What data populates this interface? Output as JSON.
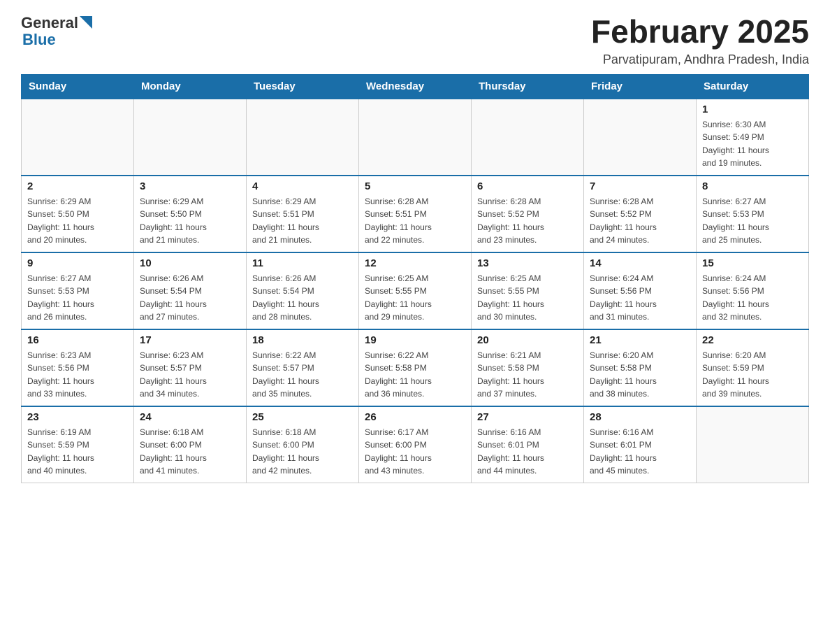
{
  "header": {
    "logo_text_general": "General",
    "logo_text_blue": "Blue",
    "title": "February 2025",
    "subtitle": "Parvatipuram, Andhra Pradesh, India"
  },
  "weekdays": [
    "Sunday",
    "Monday",
    "Tuesday",
    "Wednesday",
    "Thursday",
    "Friday",
    "Saturday"
  ],
  "weeks": [
    [
      {
        "day": "",
        "info": ""
      },
      {
        "day": "",
        "info": ""
      },
      {
        "day": "",
        "info": ""
      },
      {
        "day": "",
        "info": ""
      },
      {
        "day": "",
        "info": ""
      },
      {
        "day": "",
        "info": ""
      },
      {
        "day": "1",
        "info": "Sunrise: 6:30 AM\nSunset: 5:49 PM\nDaylight: 11 hours\nand 19 minutes."
      }
    ],
    [
      {
        "day": "2",
        "info": "Sunrise: 6:29 AM\nSunset: 5:50 PM\nDaylight: 11 hours\nand 20 minutes."
      },
      {
        "day": "3",
        "info": "Sunrise: 6:29 AM\nSunset: 5:50 PM\nDaylight: 11 hours\nand 21 minutes."
      },
      {
        "day": "4",
        "info": "Sunrise: 6:29 AM\nSunset: 5:51 PM\nDaylight: 11 hours\nand 21 minutes."
      },
      {
        "day": "5",
        "info": "Sunrise: 6:28 AM\nSunset: 5:51 PM\nDaylight: 11 hours\nand 22 minutes."
      },
      {
        "day": "6",
        "info": "Sunrise: 6:28 AM\nSunset: 5:52 PM\nDaylight: 11 hours\nand 23 minutes."
      },
      {
        "day": "7",
        "info": "Sunrise: 6:28 AM\nSunset: 5:52 PM\nDaylight: 11 hours\nand 24 minutes."
      },
      {
        "day": "8",
        "info": "Sunrise: 6:27 AM\nSunset: 5:53 PM\nDaylight: 11 hours\nand 25 minutes."
      }
    ],
    [
      {
        "day": "9",
        "info": "Sunrise: 6:27 AM\nSunset: 5:53 PM\nDaylight: 11 hours\nand 26 minutes."
      },
      {
        "day": "10",
        "info": "Sunrise: 6:26 AM\nSunset: 5:54 PM\nDaylight: 11 hours\nand 27 minutes."
      },
      {
        "day": "11",
        "info": "Sunrise: 6:26 AM\nSunset: 5:54 PM\nDaylight: 11 hours\nand 28 minutes."
      },
      {
        "day": "12",
        "info": "Sunrise: 6:25 AM\nSunset: 5:55 PM\nDaylight: 11 hours\nand 29 minutes."
      },
      {
        "day": "13",
        "info": "Sunrise: 6:25 AM\nSunset: 5:55 PM\nDaylight: 11 hours\nand 30 minutes."
      },
      {
        "day": "14",
        "info": "Sunrise: 6:24 AM\nSunset: 5:56 PM\nDaylight: 11 hours\nand 31 minutes."
      },
      {
        "day": "15",
        "info": "Sunrise: 6:24 AM\nSunset: 5:56 PM\nDaylight: 11 hours\nand 32 minutes."
      }
    ],
    [
      {
        "day": "16",
        "info": "Sunrise: 6:23 AM\nSunset: 5:56 PM\nDaylight: 11 hours\nand 33 minutes."
      },
      {
        "day": "17",
        "info": "Sunrise: 6:23 AM\nSunset: 5:57 PM\nDaylight: 11 hours\nand 34 minutes."
      },
      {
        "day": "18",
        "info": "Sunrise: 6:22 AM\nSunset: 5:57 PM\nDaylight: 11 hours\nand 35 minutes."
      },
      {
        "day": "19",
        "info": "Sunrise: 6:22 AM\nSunset: 5:58 PM\nDaylight: 11 hours\nand 36 minutes."
      },
      {
        "day": "20",
        "info": "Sunrise: 6:21 AM\nSunset: 5:58 PM\nDaylight: 11 hours\nand 37 minutes."
      },
      {
        "day": "21",
        "info": "Sunrise: 6:20 AM\nSunset: 5:58 PM\nDaylight: 11 hours\nand 38 minutes."
      },
      {
        "day": "22",
        "info": "Sunrise: 6:20 AM\nSunset: 5:59 PM\nDaylight: 11 hours\nand 39 minutes."
      }
    ],
    [
      {
        "day": "23",
        "info": "Sunrise: 6:19 AM\nSunset: 5:59 PM\nDaylight: 11 hours\nand 40 minutes."
      },
      {
        "day": "24",
        "info": "Sunrise: 6:18 AM\nSunset: 6:00 PM\nDaylight: 11 hours\nand 41 minutes."
      },
      {
        "day": "25",
        "info": "Sunrise: 6:18 AM\nSunset: 6:00 PM\nDaylight: 11 hours\nand 42 minutes."
      },
      {
        "day": "26",
        "info": "Sunrise: 6:17 AM\nSunset: 6:00 PM\nDaylight: 11 hours\nand 43 minutes."
      },
      {
        "day": "27",
        "info": "Sunrise: 6:16 AM\nSunset: 6:01 PM\nDaylight: 11 hours\nand 44 minutes."
      },
      {
        "day": "28",
        "info": "Sunrise: 6:16 AM\nSunset: 6:01 PM\nDaylight: 11 hours\nand 45 minutes."
      },
      {
        "day": "",
        "info": ""
      }
    ]
  ]
}
